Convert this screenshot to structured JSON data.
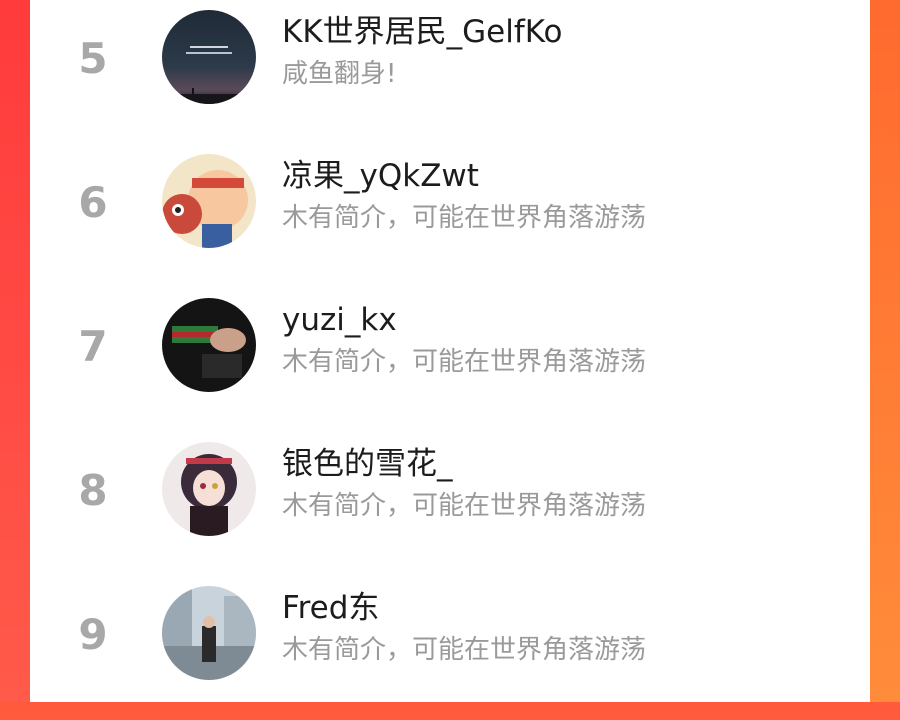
{
  "list": {
    "items": [
      {
        "rank": "5",
        "name": "KK世界居民_GelfKo",
        "bio": "咸鱼翻身!"
      },
      {
        "rank": "6",
        "name": "凉果_yQkZwt",
        "bio": "木有简介，可能在世界角落游荡"
      },
      {
        "rank": "7",
        "name": "yuzi_kx",
        "bio": "木有简介，可能在世界角落游荡"
      },
      {
        "rank": "8",
        "name": "银色的雪花_",
        "bio": "木有简介，可能在世界角落游荡"
      },
      {
        "rank": "9",
        "name": "Fred东",
        "bio": "木有简介，可能在世界角落游荡"
      }
    ]
  },
  "colors": {
    "rank_text": "#a8a8a8",
    "name_text": "#1c1c1c",
    "bio_text": "#9a9a9a",
    "frame_left": "#ff3b3b",
    "frame_right": "#ff7a34"
  }
}
